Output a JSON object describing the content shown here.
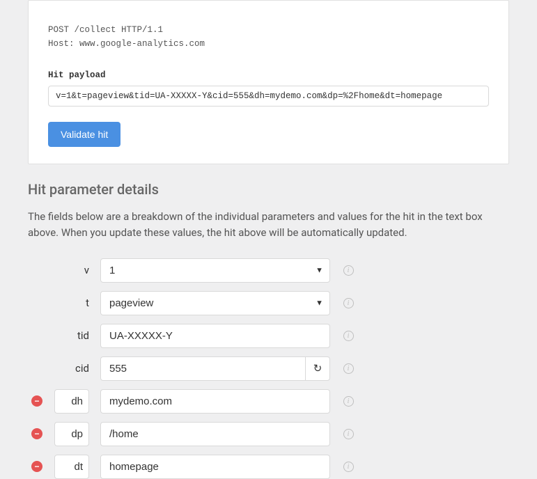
{
  "request": {
    "line1": "POST /collect HTTP/1.1",
    "line2": "Host: www.google-analytics.com",
    "payload_label": "Hit payload",
    "payload_value": "v=1&t=pageview&tid=UA-XXXXX-Y&cid=555&dh=mydemo.com&dp=%2Fhome&dt=homepage",
    "validate_label": "Validate hit"
  },
  "details": {
    "title": "Hit parameter details",
    "desc": "The fields below are a breakdown of the individual parameters and values for the hit in the text box above. When you update these values, the hit above will be automatically updated."
  },
  "params": [
    {
      "key": "v",
      "value": "1",
      "type": "select",
      "removable": false
    },
    {
      "key": "t",
      "value": "pageview",
      "type": "select",
      "removable": false
    },
    {
      "key": "tid",
      "value": "UA-XXXXX-Y",
      "type": "text",
      "removable": false
    },
    {
      "key": "cid",
      "value": "555",
      "type": "text",
      "removable": false,
      "refresh": true
    },
    {
      "key": "dh",
      "value": "mydemo.com",
      "type": "text",
      "removable": true
    },
    {
      "key": "dp",
      "value": "/home",
      "type": "text",
      "removable": true
    },
    {
      "key": "dt",
      "value": "homepage",
      "type": "text",
      "removable": true
    }
  ]
}
